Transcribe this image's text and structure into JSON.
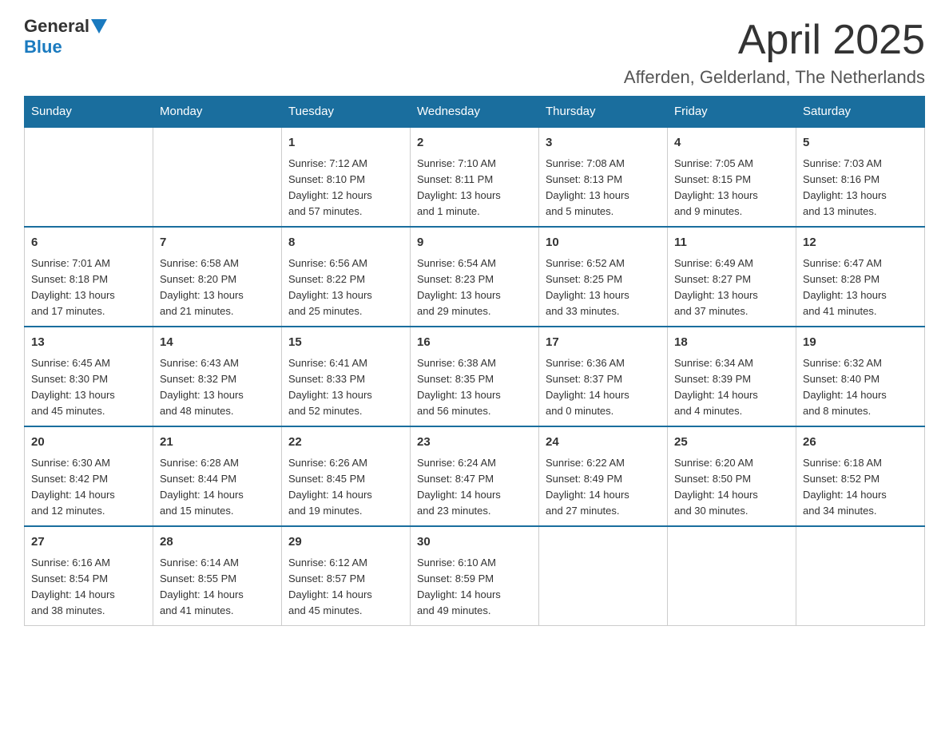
{
  "header": {
    "logo": {
      "general": "General",
      "blue": "Blue"
    },
    "title": "April 2025",
    "subtitle": "Afferden, Gelderland, The Netherlands"
  },
  "calendar": {
    "weekdays": [
      "Sunday",
      "Monday",
      "Tuesday",
      "Wednesday",
      "Thursday",
      "Friday",
      "Saturday"
    ],
    "weeks": [
      [
        {
          "day": "",
          "info": ""
        },
        {
          "day": "",
          "info": ""
        },
        {
          "day": "1",
          "info": "Sunrise: 7:12 AM\nSunset: 8:10 PM\nDaylight: 12 hours\nand 57 minutes."
        },
        {
          "day": "2",
          "info": "Sunrise: 7:10 AM\nSunset: 8:11 PM\nDaylight: 13 hours\nand 1 minute."
        },
        {
          "day": "3",
          "info": "Sunrise: 7:08 AM\nSunset: 8:13 PM\nDaylight: 13 hours\nand 5 minutes."
        },
        {
          "day": "4",
          "info": "Sunrise: 7:05 AM\nSunset: 8:15 PM\nDaylight: 13 hours\nand 9 minutes."
        },
        {
          "day": "5",
          "info": "Sunrise: 7:03 AM\nSunset: 8:16 PM\nDaylight: 13 hours\nand 13 minutes."
        }
      ],
      [
        {
          "day": "6",
          "info": "Sunrise: 7:01 AM\nSunset: 8:18 PM\nDaylight: 13 hours\nand 17 minutes."
        },
        {
          "day": "7",
          "info": "Sunrise: 6:58 AM\nSunset: 8:20 PM\nDaylight: 13 hours\nand 21 minutes."
        },
        {
          "day": "8",
          "info": "Sunrise: 6:56 AM\nSunset: 8:22 PM\nDaylight: 13 hours\nand 25 minutes."
        },
        {
          "day": "9",
          "info": "Sunrise: 6:54 AM\nSunset: 8:23 PM\nDaylight: 13 hours\nand 29 minutes."
        },
        {
          "day": "10",
          "info": "Sunrise: 6:52 AM\nSunset: 8:25 PM\nDaylight: 13 hours\nand 33 minutes."
        },
        {
          "day": "11",
          "info": "Sunrise: 6:49 AM\nSunset: 8:27 PM\nDaylight: 13 hours\nand 37 minutes."
        },
        {
          "day": "12",
          "info": "Sunrise: 6:47 AM\nSunset: 8:28 PM\nDaylight: 13 hours\nand 41 minutes."
        }
      ],
      [
        {
          "day": "13",
          "info": "Sunrise: 6:45 AM\nSunset: 8:30 PM\nDaylight: 13 hours\nand 45 minutes."
        },
        {
          "day": "14",
          "info": "Sunrise: 6:43 AM\nSunset: 8:32 PM\nDaylight: 13 hours\nand 48 minutes."
        },
        {
          "day": "15",
          "info": "Sunrise: 6:41 AM\nSunset: 8:33 PM\nDaylight: 13 hours\nand 52 minutes."
        },
        {
          "day": "16",
          "info": "Sunrise: 6:38 AM\nSunset: 8:35 PM\nDaylight: 13 hours\nand 56 minutes."
        },
        {
          "day": "17",
          "info": "Sunrise: 6:36 AM\nSunset: 8:37 PM\nDaylight: 14 hours\nand 0 minutes."
        },
        {
          "day": "18",
          "info": "Sunrise: 6:34 AM\nSunset: 8:39 PM\nDaylight: 14 hours\nand 4 minutes."
        },
        {
          "day": "19",
          "info": "Sunrise: 6:32 AM\nSunset: 8:40 PM\nDaylight: 14 hours\nand 8 minutes."
        }
      ],
      [
        {
          "day": "20",
          "info": "Sunrise: 6:30 AM\nSunset: 8:42 PM\nDaylight: 14 hours\nand 12 minutes."
        },
        {
          "day": "21",
          "info": "Sunrise: 6:28 AM\nSunset: 8:44 PM\nDaylight: 14 hours\nand 15 minutes."
        },
        {
          "day": "22",
          "info": "Sunrise: 6:26 AM\nSunset: 8:45 PM\nDaylight: 14 hours\nand 19 minutes."
        },
        {
          "day": "23",
          "info": "Sunrise: 6:24 AM\nSunset: 8:47 PM\nDaylight: 14 hours\nand 23 minutes."
        },
        {
          "day": "24",
          "info": "Sunrise: 6:22 AM\nSunset: 8:49 PM\nDaylight: 14 hours\nand 27 minutes."
        },
        {
          "day": "25",
          "info": "Sunrise: 6:20 AM\nSunset: 8:50 PM\nDaylight: 14 hours\nand 30 minutes."
        },
        {
          "day": "26",
          "info": "Sunrise: 6:18 AM\nSunset: 8:52 PM\nDaylight: 14 hours\nand 34 minutes."
        }
      ],
      [
        {
          "day": "27",
          "info": "Sunrise: 6:16 AM\nSunset: 8:54 PM\nDaylight: 14 hours\nand 38 minutes."
        },
        {
          "day": "28",
          "info": "Sunrise: 6:14 AM\nSunset: 8:55 PM\nDaylight: 14 hours\nand 41 minutes."
        },
        {
          "day": "29",
          "info": "Sunrise: 6:12 AM\nSunset: 8:57 PM\nDaylight: 14 hours\nand 45 minutes."
        },
        {
          "day": "30",
          "info": "Sunrise: 6:10 AM\nSunset: 8:59 PM\nDaylight: 14 hours\nand 49 minutes."
        },
        {
          "day": "",
          "info": ""
        },
        {
          "day": "",
          "info": ""
        },
        {
          "day": "",
          "info": ""
        }
      ]
    ]
  }
}
